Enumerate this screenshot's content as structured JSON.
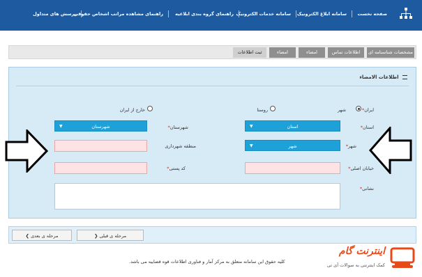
{
  "nav": {
    "home": "صفحه نخست",
    "notify": "سامانه ابلاغ الکترونیک",
    "services": "سامانه خدمات الکترونیک",
    "group_guide": "راهنمای گروه بندی ابلاغیه",
    "ranking_guide": "راهنمای مشاهده مراتب اشخاص حقوقی",
    "faq": "پرسش های متداول"
  },
  "steps": {
    "identity": "مشخصات شناسنامه ای",
    "contact": "اطلاعات تماس",
    "signature": "امضاء",
    "address": "امضاء",
    "final": "ثبت اطلاعات"
  },
  "panel": {
    "title": "اطلاعات الامضاء",
    "location": {
      "iran_label": "ایران",
      "city_label": "شهر",
      "village_label": "روستا",
      "abroad_label": "خارج از ایران"
    },
    "province": {
      "label": "استان",
      "value": "استان"
    },
    "county": {
      "label": "شهرستان",
      "value": "شهرستان"
    },
    "city": {
      "label": "شهر",
      "value": "شهر"
    },
    "district": {
      "label": "منطقه شهرداری"
    },
    "main_street": {
      "label": "خیابان اصلی"
    },
    "postal_code": {
      "label": "کد پستی"
    },
    "address": {
      "label": "نشانی"
    }
  },
  "buttons": {
    "prev": "مرحله ی قبلی",
    "next": "مرحله ی بعدی"
  },
  "footer": {
    "copyright": "کلیه حقوق این سامانه متعلق به مرکز آمار و فناوری اطلاعات قوه قضاییه می باشد."
  },
  "brand": {
    "name": "اینترنت گام",
    "tagline": "کمک اینترنتی به سوالات آی تی"
  },
  "colors": {
    "header": "#1e5aa0",
    "select": "#1ea0d8",
    "required_input": "#fde3e3",
    "panel": "#d7ebf7",
    "brand": "#e64a19"
  }
}
